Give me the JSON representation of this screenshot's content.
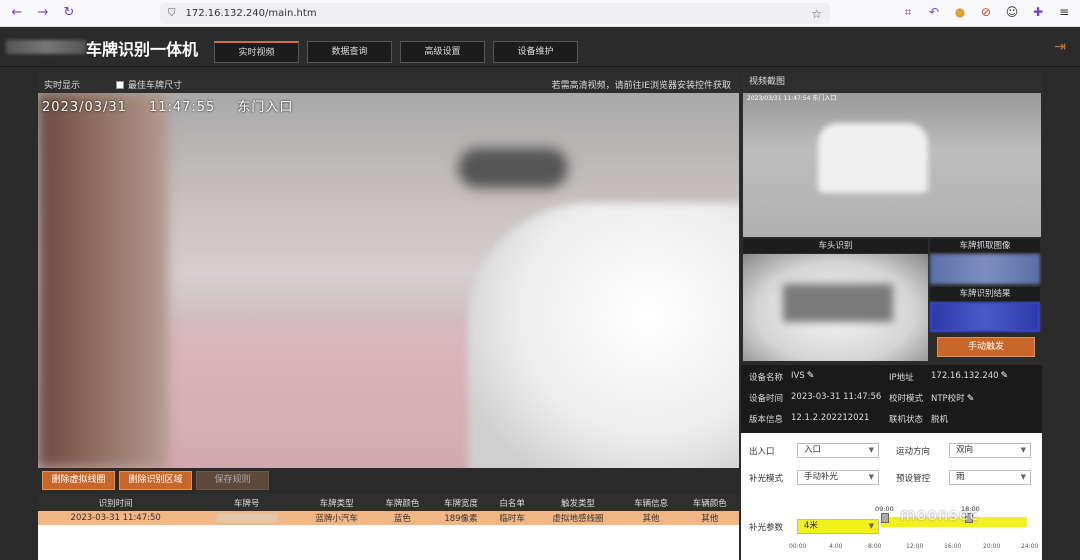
{
  "browser": {
    "url": "172.16.132.240/main.htm",
    "back_icon": "back-arrow-icon",
    "forward_icon": "forward-arrow-icon",
    "reload_icon": "reload-icon"
  },
  "header": {
    "title": "车牌识别一体机",
    "tabs": [
      {
        "label": "实时视频",
        "active": true
      },
      {
        "label": "数据查询",
        "active": false
      },
      {
        "label": "高级设置",
        "active": false
      },
      {
        "label": "设备维护",
        "active": false
      }
    ],
    "accent_color": "#e07020"
  },
  "video": {
    "realtime_label": "实时显示",
    "optimal_size_label": "最佳车牌尺寸",
    "hint": "若需高清视频，请前往IE浏览器安装控件获取",
    "stamp_date": "2023/03/31",
    "stamp_time": "11:47:55",
    "stamp_location": "东门入口"
  },
  "buttons": {
    "delete_virtual_coil": "删除虚拟线圈",
    "delete_recognition_area": "删除识别区域",
    "save_rules": "保存规则"
  },
  "results_table": {
    "headers": [
      "识别时间",
      "车牌号",
      "车牌类型",
      "车牌颜色",
      "车牌宽度",
      "白名单",
      "触发类型",
      "车辆信息",
      "车辆颜色"
    ],
    "rows": [
      [
        "2023-03-31 11:47:50",
        "",
        "蓝牌小汽车",
        "蓝色",
        "189像素",
        "临时车",
        "虚拟地感线圈",
        "其他",
        "其他"
      ]
    ]
  },
  "right_panel": {
    "snapshot_label": "视频截图",
    "snapshot_stamp": "2023/03/31  11:47:54  东门入口",
    "front_recognition_label": "车头识别",
    "plate_capture_label": "车牌抓取图像",
    "plate_result_label": "车牌识别结果",
    "trigger_button": "手动触发"
  },
  "device_info": {
    "device_name_label": "设备名称",
    "device_name": "IVS",
    "ip_label": "IP地址",
    "ip": "172.16.132.240",
    "device_time_label": "设备时间",
    "device_time": "2023-03-31 11:47:56",
    "timing_mode_label": "校时模式",
    "timing_mode": "NTP校时",
    "version_label": "版本信息",
    "version": "12.1.2.202212021",
    "online_label": "联机状态",
    "online": "脱机"
  },
  "settings": {
    "entrance_label": "出入口",
    "entrance_value": "入口",
    "direction_label": "运动方向",
    "direction_value": "双向",
    "fill_mode_label": "补光模式",
    "fill_mode_value": "手动补光",
    "preset_label": "预设管控",
    "preset_value": "雨",
    "fill_param_label": "补光参数",
    "fill_param_value": "4米",
    "slider_start": "09:00",
    "slider_end": "18:00",
    "ticks": [
      "00:00",
      "4:00",
      "8:00",
      "12:00",
      "16:00",
      "20:00",
      "24:00"
    ]
  },
  "watermark": "moonsec"
}
